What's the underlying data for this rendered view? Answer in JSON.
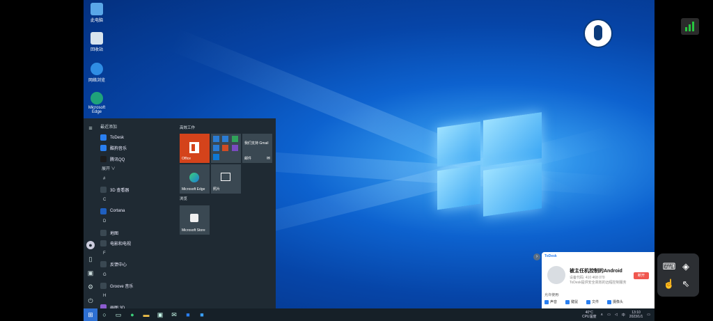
{
  "desktop": {
    "icons": [
      {
        "label": "此电脑"
      },
      {
        "label": "回收站"
      },
      {
        "label": "网络浏览"
      },
      {
        "label": "Microsoft Edge"
      }
    ]
  },
  "start_menu": {
    "recent_title": "最近添加",
    "recent_apps": [
      {
        "label": "ToDesk",
        "color": "#2a7ff0"
      },
      {
        "label": "酷狗音乐",
        "color": "#2a7ff0"
      },
      {
        "label": "腾讯QQ",
        "color": "#1c1c1c"
      }
    ],
    "expand_label": "展开 ∨",
    "sections": [
      {
        "letter": "#",
        "apps": [
          {
            "label": "3D 查看器",
            "color": "#3a4852"
          }
        ]
      },
      {
        "letter": "C",
        "apps": [
          {
            "label": "Cortana",
            "color": "#1f5fbf"
          }
        ]
      },
      {
        "letter": "D",
        "apps": [
          {
            "label": "地图",
            "color": "#3a4852"
          },
          {
            "label": "电影和电视",
            "color": "#3a4852"
          }
        ]
      },
      {
        "letter": "F",
        "apps": [
          {
            "label": "反馈中心",
            "color": "#3a4852"
          }
        ]
      },
      {
        "letter": "G",
        "apps": [
          {
            "label": "Groove 音乐",
            "color": "#3a4852"
          }
        ]
      },
      {
        "letter": "H",
        "apps": [
          {
            "label": "画图 3D",
            "color": "#8c5cd0"
          }
        ]
      }
    ],
    "tiles": {
      "group1": "高效工作",
      "group2": "浏览",
      "office_label": "Office",
      "gmail_label": "我们支持 Gmail",
      "mail_label": "邮件",
      "edge_label": "Microsoft Edge",
      "photos_label": "照片",
      "store_label": "Microsoft Store"
    }
  },
  "taskbar": {
    "tray_temp": "40°C",
    "tray_cpu": "CPU温度",
    "clock_time": "13:10",
    "clock_date": "2023/1/1"
  },
  "todesk": {
    "brand": "ToDesk",
    "title": "被主任机控制的Android",
    "line1": "设备代码: 410 468 070",
    "line2": "ToDesk提供安全高效的远程控制服务",
    "action": "断开",
    "perm_label": "允许使用:",
    "perms": [
      "声音",
      "键鼠",
      "文件",
      "摄像头"
    ]
  }
}
